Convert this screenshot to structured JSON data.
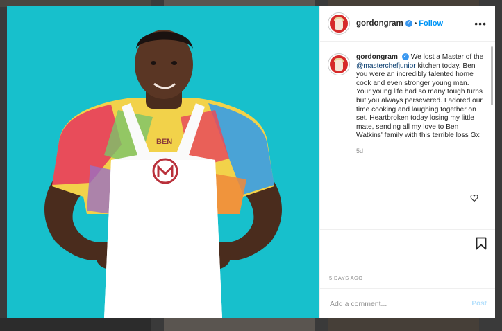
{
  "post": {
    "username": "gordongram",
    "verified_mark": "✓",
    "separator": "•",
    "follow_label": "Follow",
    "more_label": "•••",
    "caption_username": "gordongram",
    "caption_part1": "We lost a Master of the",
    "caption_mention": "@masterchefjunior",
    "caption_part2": "kitchen today. Ben you were an incredibly talented home cook and even stronger young man. Your young life had so many tough turns but you always persevered. I adored our time cooking and laughing together on set. Heartbroken today losing my little mate, sending all my love to Ben Watkins' family with this terrible loss Gx",
    "caption_age": "5d",
    "posted_date": "5 DAYS AGO",
    "comment_placeholder": "Add a comment...",
    "post_label": "Post",
    "apron_name": "BEN"
  },
  "icons": {
    "avatar": "profile-avatar",
    "heart": "heart-icon",
    "bookmark": "bookmark-icon",
    "more": "more-options-icon"
  },
  "colors": {
    "photo_background": "#17c0cc",
    "link": "#0095f6",
    "verified": "#3897f0",
    "post_disabled": "#b2dffc"
  }
}
